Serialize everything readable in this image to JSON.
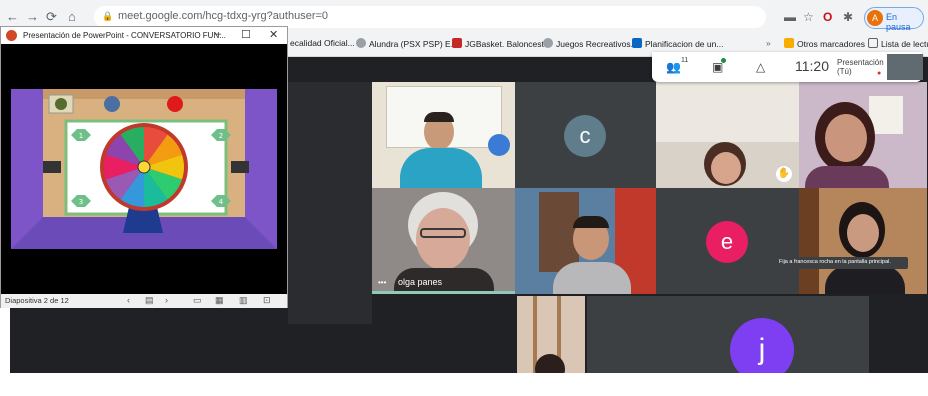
{
  "browser": {
    "url": "meet.google.com/hcg-tdxg-yrg?authuser=0",
    "pause_label": "En pausa",
    "profile_initial": "A",
    "bookmarks": [
      "ecalidad Oficial...",
      "Alundra (PSX PSP) E...",
      "JGBasket. Baloncest...",
      "Juegos Recreativos...",
      "Planificacion de un..."
    ],
    "other_bookmarks": "Otros marcadores",
    "reading_list": "Lista de lectu",
    "more_chevron": "»"
  },
  "ppt": {
    "title": "Presentación de PowerPoint  -  CONVERSATORIO FUN...",
    "slide_status": "Diapositiva 2 de 12"
  },
  "meet": {
    "participants_count": "11",
    "time": "11:20",
    "presenting_label": "Presentación",
    "presenting_sub": "(Tú)",
    "you_label": "Tú",
    "tiles": {
      "c_initial": "c",
      "e_initial": "e",
      "j_initial": "j",
      "olga_name": "olga panes",
      "pin_tooltip": "Fija a francesca rocha en la pantalla principal."
    }
  },
  "colors": {
    "c_avatar": "#607d8b",
    "e_avatar": "#e91e63",
    "j_avatar": "#7e3ff2"
  }
}
